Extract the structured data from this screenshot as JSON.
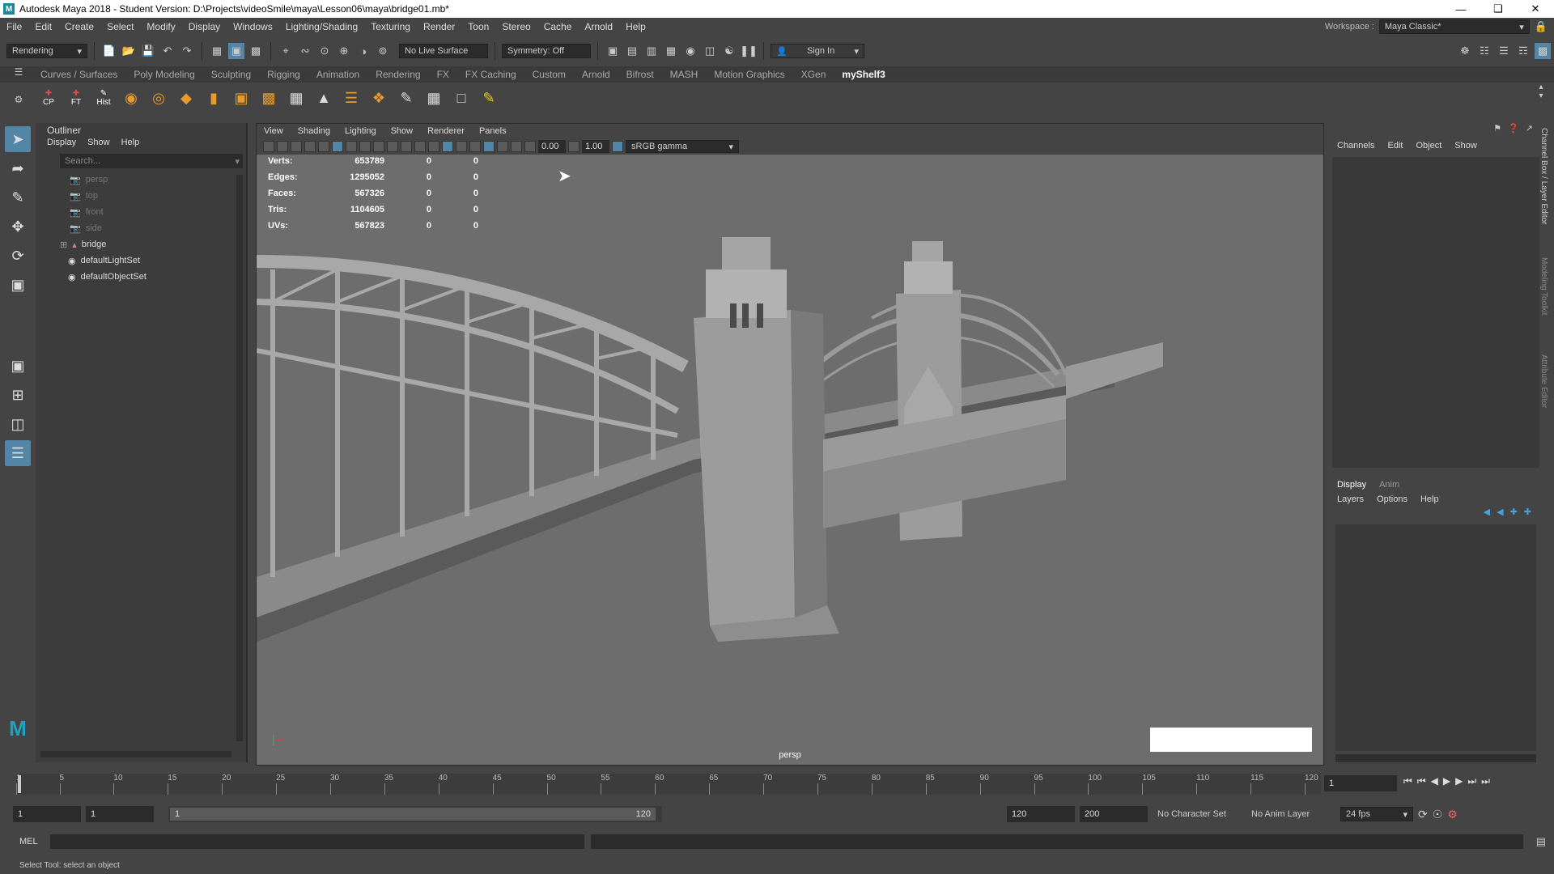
{
  "window": {
    "title": "Autodesk Maya 2018 - Student Version: D:\\Projects\\videoSmile\\maya\\Lesson06\\maya\\bridge01.mb*",
    "logo": "M",
    "min_icon": "minimize-icon",
    "max_icon": "restore-icon",
    "close_icon": "close-icon"
  },
  "menu": [
    "File",
    "Edit",
    "Create",
    "Select",
    "Modify",
    "Display",
    "Windows",
    "Lighting/Shading",
    "Texturing",
    "Render",
    "Toon",
    "Stereo",
    "Cache",
    "Arnold",
    "Help"
  ],
  "workspace": {
    "label": "Workspace :",
    "value": "Maya Classic*"
  },
  "statusline": {
    "menuset": "Rendering",
    "live_surface": "No Live Surface",
    "symmetry": "Symmetry: Off",
    "sign_in": "Sign In"
  },
  "shelf_tabs": [
    "Curves / Surfaces",
    "Poly Modeling",
    "Sculpting",
    "Rigging",
    "Animation",
    "Rendering",
    "FX",
    "FX Caching",
    "Custom",
    "Arnold",
    "Bifrost",
    "MASH",
    "Motion Graphics",
    "XGen",
    "myShelf3"
  ],
  "shelf_active": "myShelf3",
  "shelf_icons": {
    "cp": "CP",
    "ft": "FT",
    "hist": "Hist"
  },
  "outliner": {
    "title": "Outliner",
    "menu": [
      "Display",
      "Show",
      "Help"
    ],
    "search_placeholder": "Search...",
    "cameras": [
      "persp",
      "top",
      "front",
      "side"
    ],
    "objects": [
      {
        "name": "bridge",
        "icon": "transform-icon",
        "expand": "⊞"
      },
      {
        "name": "defaultLightSet",
        "icon": "set-icon"
      },
      {
        "name": "defaultObjectSet",
        "icon": "set-icon"
      }
    ]
  },
  "viewport": {
    "menu": [
      "View",
      "Shading",
      "Lighting",
      "Show",
      "Renderer",
      "Panels"
    ],
    "exposure": "0.00",
    "gamma": "1.00",
    "colorspace": "sRGB gamma",
    "camera_label": "persp",
    "hud": [
      {
        "label": "Verts:",
        "v1": "653789",
        "v2": "0",
        "v3": "0"
      },
      {
        "label": "Edges:",
        "v1": "1295052",
        "v2": "0",
        "v3": "0"
      },
      {
        "label": "Faces:",
        "v1": "567326",
        "v2": "0",
        "v3": "0"
      },
      {
        "label": "Tris:",
        "v1": "1104605",
        "v2": "0",
        "v3": "0"
      },
      {
        "label": "UVs:",
        "v1": "567823",
        "v2": "0",
        "v3": "0"
      }
    ]
  },
  "channelbox": {
    "menu": [
      "Channels",
      "Edit",
      "Object",
      "Show"
    ],
    "layer_tabs": [
      "Display",
      "Anim"
    ],
    "layer_menu": [
      "Layers",
      "Options",
      "Help"
    ],
    "side_tabs": [
      "Channel Box / Layer Editor",
      "Modeling Toolkit",
      "Attribute Editor"
    ]
  },
  "timeline": {
    "ticks": [
      "1",
      "5",
      "10",
      "15",
      "20",
      "25",
      "30",
      "35",
      "40",
      "45",
      "50",
      "55",
      "60",
      "65",
      "70",
      "75",
      "80",
      "85",
      "90",
      "95",
      "100",
      "105",
      "110",
      "115",
      "120"
    ],
    "current_frame": "1",
    "range_start": "1",
    "range_inner_start": "1",
    "range_inner_marker": "1",
    "range_inner_end": "120",
    "range_end": "120",
    "anim_end": "200",
    "character_set": "No Character Set",
    "anim_layer": "No Anim Layer",
    "fps": "24 fps"
  },
  "cmdline": {
    "label": "MEL"
  },
  "helpline": "Select Tool: select an object"
}
